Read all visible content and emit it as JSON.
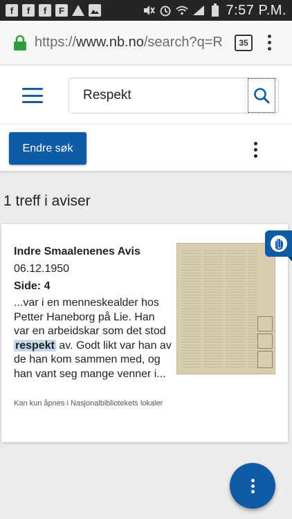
{
  "status_bar": {
    "time": "7:57 P.M.",
    "notification_icons": [
      "facebook-icon",
      "facebook-icon",
      "facebook-icon",
      "flipboard-icon",
      "warning-icon",
      "image-icon"
    ],
    "system_icons": [
      "mute-icon",
      "alarm-icon",
      "wifi-icon",
      "signal-icon",
      "battery-icon"
    ]
  },
  "browser": {
    "url_scheme": "https://",
    "url_host": "www.nb.no",
    "url_path": "/search?q=R",
    "tab_count": "35"
  },
  "search": {
    "query": "Respekt"
  },
  "toolbar": {
    "edit_search_label": "Endre søk"
  },
  "results": {
    "count_label": "1 treff i aviser",
    "items": [
      {
        "newspaper": "Indre Smaalenenes Avis",
        "date": "06.12.1950",
        "page": "Side: 4",
        "snippet_before": "...var i en menneskealder hos Petter Haneborg på Lie. Han var en arbeidskar som det stod ",
        "snippet_highlight": "respekt",
        "snippet_after": " av. Godt likt var han av de han kom sammen med, og han vant seg mange venner i...",
        "access_note": "Kan kun åpnes i Nasjonalbibliotekets lokaler"
      }
    ]
  },
  "colors": {
    "brand_blue": "#0f5ba6",
    "highlight": "#c5d8ea"
  }
}
